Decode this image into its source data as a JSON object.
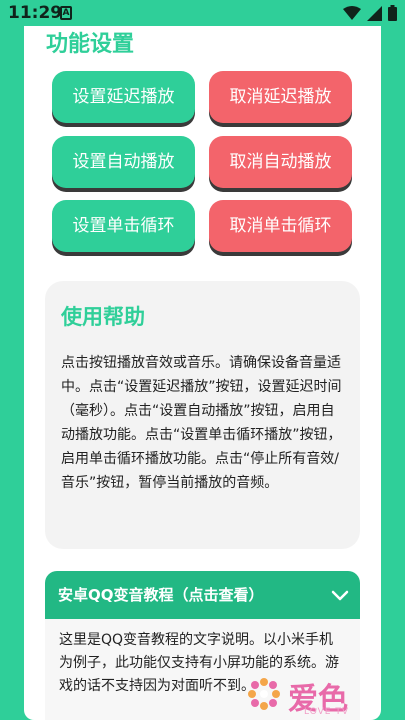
{
  "status_bar": {
    "time": "11:29",
    "notification_glyph": "A"
  },
  "card": {
    "title": "功能设置",
    "buttons": [
      {
        "label": "设置延迟播放",
        "color": "#2fcf99"
      },
      {
        "label": "取消延迟播放",
        "color": "#f3646b"
      },
      {
        "label": "设置自动播放",
        "color": "#2fcf99"
      },
      {
        "label": "取消自动播放",
        "color": "#f3646b"
      },
      {
        "label": "设置单击循环",
        "color": "#2fcf99"
      },
      {
        "label": "取消单击循环",
        "color": "#f3646b"
      }
    ]
  },
  "help": {
    "heading": "使用帮助",
    "text": "点击按钮播放音效或音乐。请确保设备音量适中。点击“设置延迟播放”按钮，设置延迟时间（毫秒）。点击“设置自动播放”按钮，启用自动播放功能。点击“设置单击循环播放”按钮，启用单击循环播放功能。点击“停止所有音效/音乐”按钮，暂停当前播放的音频。"
  },
  "tutorial": {
    "header": "安卓QQ变音教程（点击查看）",
    "body": "这里是QQ变音教程的文字说明。以小米手机为例子，此功能仅支持有小屏功能的系统。游戏的话不支持因为对面听不到。"
  },
  "watermark": {
    "logo": "爱色",
    "sub": "LOVE TV"
  },
  "colors": {
    "accent": "#2fcf99",
    "danger": "#f3646b",
    "header": "#22b884"
  }
}
